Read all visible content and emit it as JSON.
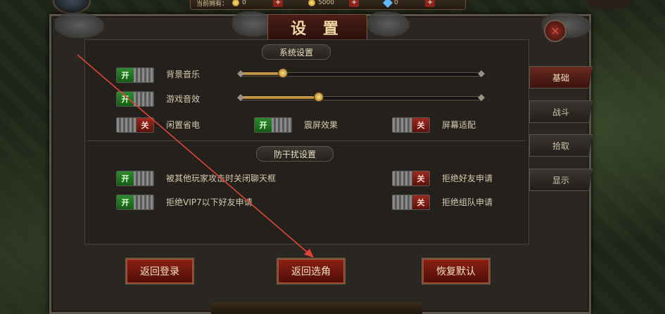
{
  "header": {
    "title": "设 置",
    "resources_label": "当前拥有：",
    "resources": [
      {
        "icon": "gold-coin-icon",
        "value": "0"
      },
      {
        "icon": "silver-coin-icon",
        "value": "5000"
      },
      {
        "icon": "diamond-icon",
        "value": "0"
      }
    ],
    "plus_label": "+",
    "close_icon": "close-icon",
    "close_glyph": "✕"
  },
  "system": {
    "title": "系统设置",
    "music_label": "背景音乐",
    "music_value": 0.17,
    "sfx_label": "游戏音效",
    "sfx_value": 0.32,
    "power_save_label": "闲置省电",
    "power_save_state": "关",
    "shake_label": "震屏效果",
    "shake_state": "开",
    "screen_fit_label": "屏幕适配",
    "screen_fit_state": "关",
    "music_toggle_state": "开",
    "sfx_toggle_state": "开"
  },
  "anti": {
    "title": "防干扰设置",
    "close_chat_label": "被其他玩家攻击时关闭聊天框",
    "close_chat_state": "开",
    "reject_vip_label": "拒绝VIP7以下好友申请",
    "reject_vip_state": "开",
    "reject_friend_label": "拒绝好友申请",
    "reject_friend_state": "关",
    "reject_team_label": "拒绝组队申请",
    "reject_team_state": "关"
  },
  "tabs": [
    {
      "label": "基础",
      "active": true
    },
    {
      "label": "战斗",
      "active": false
    },
    {
      "label": "拾取",
      "active": false
    },
    {
      "label": "显示",
      "active": false
    }
  ],
  "buttons": {
    "return_login": "返回登录",
    "return_select": "返回选角",
    "restore_default": "恢复默认"
  },
  "colors": {
    "on": "#1e7a1e",
    "off": "#8a1f14",
    "accent_gold": "#d8b060",
    "annotation_arrow": "#e0453a"
  }
}
